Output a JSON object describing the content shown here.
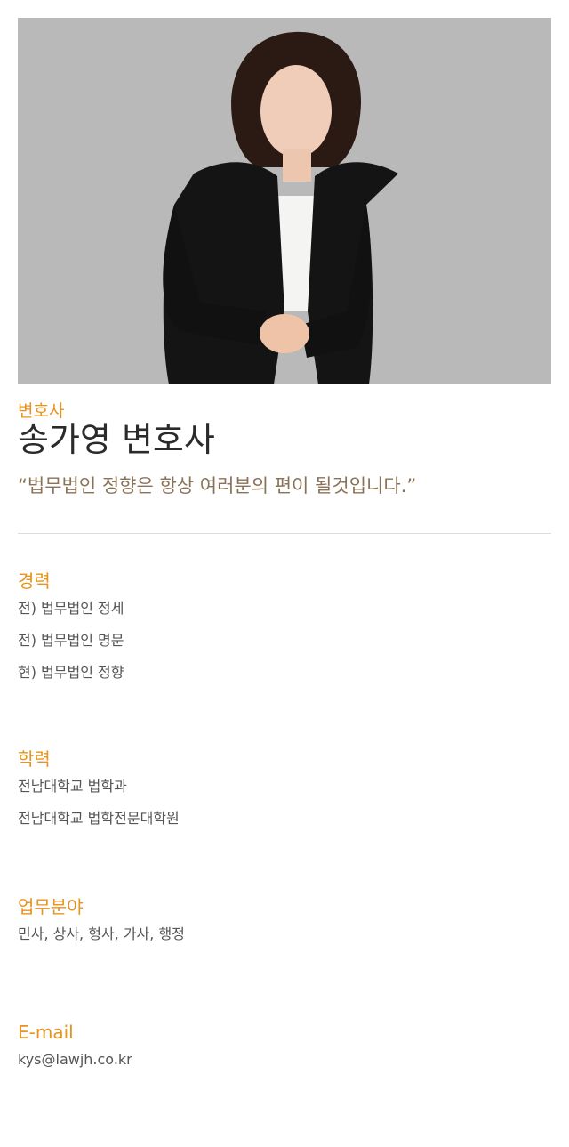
{
  "profile": {
    "role": "변호사",
    "name": "송가영 변호사",
    "motto": "“법무법인 정향은 항상 여러분의 편이 될것입니다.”"
  },
  "sections": {
    "career": {
      "title": "경력",
      "items": [
        "전) 법무법인 정세",
        "전) 법무법인 명문",
        "현) 법무법인 정향"
      ]
    },
    "education": {
      "title": "학력",
      "items": [
        "전남대학교 법학과",
        "전남대학교 법학전문대학원"
      ]
    },
    "practice": {
      "title": "업무분야",
      "items": [
        "민사, 상사, 형사, 가사, 행정"
      ]
    },
    "email": {
      "title": "E-mail",
      "value": "kys@lawjh.co.kr"
    }
  },
  "colors": {
    "accent": "#e8931e",
    "motto": "#8a7257",
    "photo_background": "#b7b7b7"
  }
}
